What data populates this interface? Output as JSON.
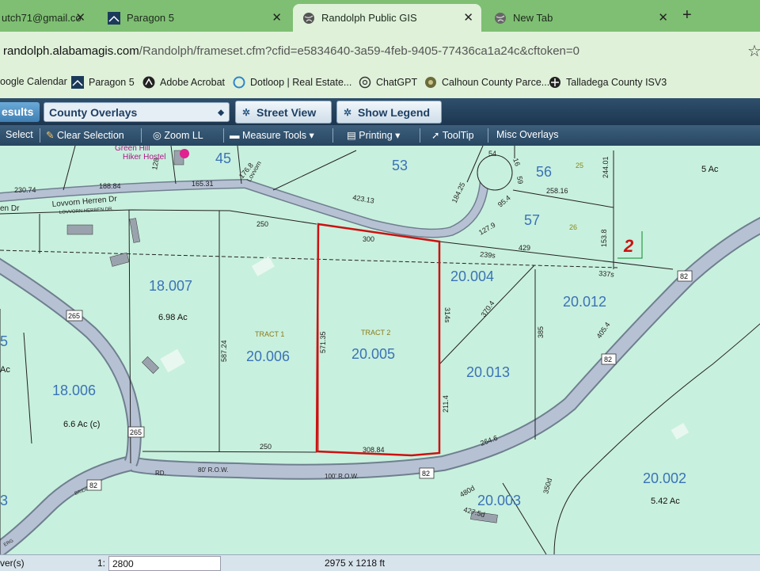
{
  "browser": {
    "tabs": [
      {
        "label": "utch71@gmail.co",
        "active": false
      },
      {
        "label": "Paragon 5",
        "active": false
      },
      {
        "label": "Randolph Public GIS",
        "active": true
      },
      {
        "label": "New Tab",
        "active": false
      }
    ],
    "close_glyph": "✕",
    "new_tab_glyph": "+",
    "url_host": "randolph.alabamagis.com",
    "url_path": "/Randolph/frameset.cfm?cfid=e5834640-3a59-4feb-9405-77436ca1a24c&cftoken=0",
    "star_glyph": "☆",
    "bookmarks": [
      {
        "label": "oogle Calendar",
        "icon": "calendar-icon"
      },
      {
        "label": "Paragon 5",
        "icon": "paragon-icon"
      },
      {
        "label": "Adobe Acrobat",
        "icon": "acrobat-icon"
      },
      {
        "label": "Dotloop | Real Estate...",
        "icon": "dotloop-icon"
      },
      {
        "label": "ChatGPT",
        "icon": "chatgpt-icon"
      },
      {
        "label": "Calhoun County Parce...",
        "icon": "calhoun-icon"
      },
      {
        "label": "Talladega County ISV3",
        "icon": "talladega-icon"
      }
    ]
  },
  "toolbar": {
    "results": "esults",
    "overlay_select": "County Overlays",
    "street_view": "Street View",
    "show_legend": "Show Legend",
    "select": "Select",
    "clear_selection": "Clear Selection",
    "zoom_ll": "Zoom LL",
    "measure_tools": "Measure Tools ▾",
    "printing": "Printing ▾",
    "tooltip": "ToolTip",
    "misc_overlays": "Misc Overlays"
  },
  "map": {
    "parcels": [
      {
        "id": "45"
      },
      {
        "id": "53"
      },
      {
        "id": "56"
      },
      {
        "id": "57"
      },
      {
        "id": "18.007"
      },
      {
        "id": "20.004"
      },
      {
        "id": "20.012"
      },
      {
        "id": "20.006"
      },
      {
        "id": "20.005"
      },
      {
        "id": "20.013"
      },
      {
        "id": "18.006"
      },
      {
        "id": "20.003"
      },
      {
        "id": "20.002"
      },
      {
        "id": "5"
      },
      {
        "id": "3"
      }
    ],
    "acreage": [
      "6.98 Ac",
      "6.6 Ac (c)",
      "5.42 Ac",
      "5 Ac",
      "Ac"
    ],
    "tracts": [
      "TRACT 1",
      "TRACT 2"
    ],
    "road_names": [
      "Lovvorn Herren Dr",
      "LOVVORN HERREN DR.",
      "en Dr",
      "Lovvorn"
    ],
    "row_labels": [
      "80' R.O.W.",
      "100' R.O.W.",
      "RD.",
      "BRIDGE",
      "ERG"
    ],
    "route_shields": [
      "82",
      "82",
      "82",
      "82",
      "265",
      "265"
    ],
    "dimensions": [
      "230.74",
      "188.84",
      "165.31",
      "176.8",
      "128",
      "423.13",
      "184.25",
      "54",
      "16",
      "59",
      "258.16",
      "244.01",
      "95.4",
      "127.9",
      "153.8",
      "250",
      "300",
      "239s",
      "429",
      "337s",
      "571.35",
      "314s",
      "587.24",
      "370.4",
      "385",
      "405.4",
      "211.4",
      "250",
      "308.84",
      "264.6",
      "350d",
      "480d",
      "427.5d"
    ],
    "lot_numbers": [
      "25",
      "26"
    ],
    "section_number": "2",
    "poi": [
      "Green Hill",
      "Hiker Hostel"
    ]
  },
  "status": {
    "layers": "ver(s)",
    "scale_prefix": "1:",
    "scale": "2800",
    "extent": "2975 x 1218 ft"
  },
  "colors": {
    "map_bg": "#c8f0de",
    "road_fill": "#b6c2d4",
    "parcel_id": "#3a73b6",
    "highlight": "#cc1111",
    "tab_bar": "#7fbf73"
  }
}
